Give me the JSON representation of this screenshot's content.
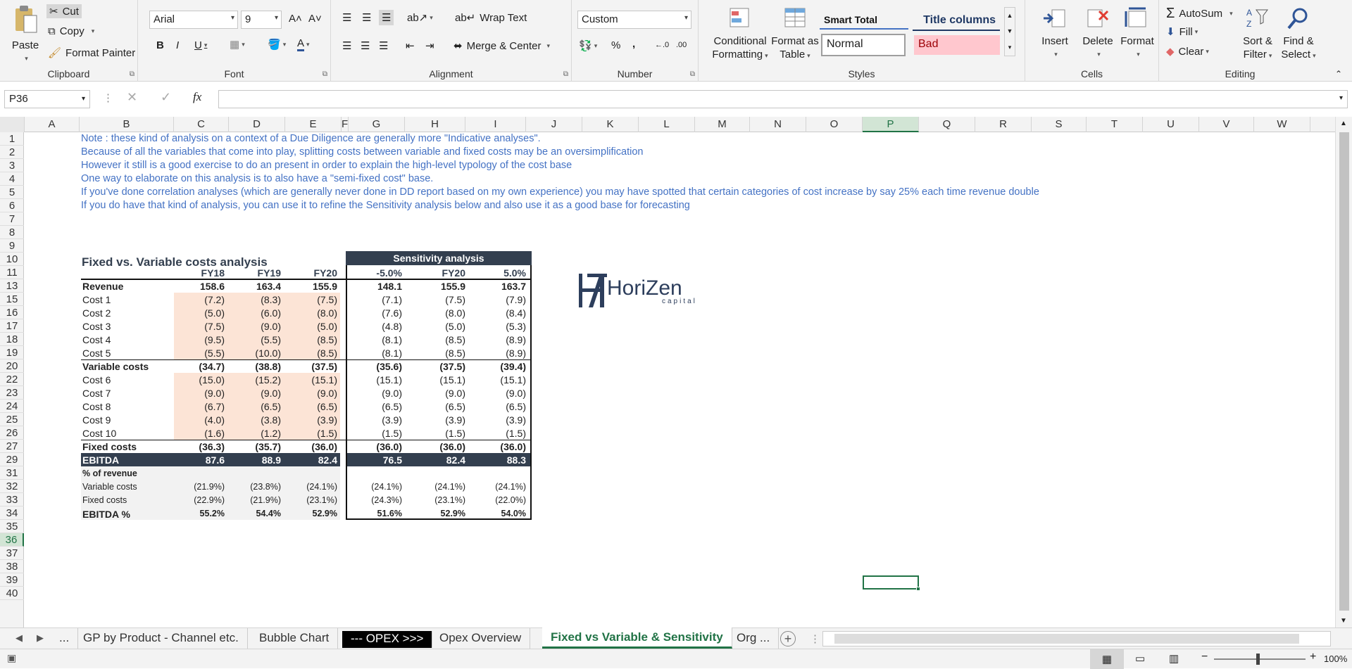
{
  "ribbon": {
    "clipboard": {
      "paste": "Paste",
      "cut": "Cut",
      "copy": "Copy",
      "format_painter": "Format Painter",
      "label": "Clipboard"
    },
    "font": {
      "name": "Arial",
      "size": "9",
      "label": "Font",
      "bold": "B",
      "italic": "I",
      "underline": "U"
    },
    "alignment": {
      "wrap_text": "Wrap Text",
      "merge_center": "Merge & Center",
      "label": "Alignment"
    },
    "number": {
      "format": "Custom",
      "percent": "%",
      "comma": ",",
      "label": "Number"
    },
    "styles": {
      "conditional": "Conditional",
      "conditional2": "Formatting",
      "format_as": "Format as",
      "format_as2": "Table",
      "smart_total": "Smart Total",
      "title_columns": "Title columns",
      "normal": "Normal",
      "bad": "Bad",
      "label": "Styles"
    },
    "cells": {
      "insert": "Insert",
      "delete": "Delete",
      "format": "Format",
      "label": "Cells"
    },
    "editing": {
      "autosum": "AutoSum",
      "fill": "Fill",
      "clear": "Clear",
      "sort": "Sort &",
      "sort2": "Filter",
      "find": "Find &",
      "find2": "Select",
      "label": "Editing"
    }
  },
  "formula_bar": {
    "name_box": "P36",
    "fx": "fx",
    "value": ""
  },
  "columns": [
    "A",
    "B",
    "C",
    "D",
    "E",
    "F",
    "G",
    "H",
    "I",
    "J",
    "K",
    "L",
    "M",
    "N",
    "O",
    "P",
    "Q",
    "R",
    "S",
    "T",
    "U",
    "V",
    "W"
  ],
  "rows": [
    "1",
    "2",
    "3",
    "4",
    "5",
    "6",
    "7",
    "8",
    "9",
    "10",
    "11",
    "13",
    "15",
    "16",
    "17",
    "18",
    "19",
    "20",
    "22",
    "23",
    "24",
    "25",
    "26",
    "27",
    "29",
    "31",
    "32",
    "33",
    "34",
    "35",
    "36",
    "37",
    "38",
    "39",
    "40"
  ],
  "notes": [
    "Note : these kind of analysis on a context of a Due Diligence are generally more \"Indicative analyses\".",
    "Because of all the variables that come into play, splitting costs between variable and fixed costs may be an oversimplification",
    "However it still is a good exercise to do an present in order to explain the high-level typology of the cost base",
    "One way to elaborate on this analysis is to also have a \"semi-fixed cost\" base.",
    "If you've done correlation analyses (which are generally never done in DD report based on my own experience) you may have spotted that certain categories of cost increase by say 25% each time revenue double",
    "If you do have that kind of analysis, you can use it to refine the Sensitivity analysis below and also use it as a good base for forecasting"
  ],
  "table": {
    "title": "Fixed vs. Variable costs analysis",
    "sensitivity_title": "Sensitivity analysis",
    "headers": [
      "FY18",
      "FY19",
      "FY20",
      "-5.0%",
      "FY20",
      "5.0%"
    ],
    "revenue": {
      "label": "Revenue",
      "values": [
        "158.6",
        "163.4",
        "155.9",
        "148.1",
        "155.9",
        "163.7"
      ]
    },
    "variable_rows": [
      {
        "label": "Cost 1",
        "values": [
          "(7.2)",
          "(8.3)",
          "(7.5)",
          "(7.1)",
          "(7.5)",
          "(7.9)"
        ]
      },
      {
        "label": "Cost 2",
        "values": [
          "(5.0)",
          "(6.0)",
          "(8.0)",
          "(7.6)",
          "(8.0)",
          "(8.4)"
        ]
      },
      {
        "label": "Cost 3",
        "values": [
          "(7.5)",
          "(9.0)",
          "(5.0)",
          "(4.8)",
          "(5.0)",
          "(5.3)"
        ]
      },
      {
        "label": "Cost 4",
        "values": [
          "(9.5)",
          "(5.5)",
          "(8.5)",
          "(8.1)",
          "(8.5)",
          "(8.9)"
        ]
      },
      {
        "label": "Cost 5",
        "values": [
          "(5.5)",
          "(10.0)",
          "(8.5)",
          "(8.1)",
          "(8.5)",
          "(8.9)"
        ]
      }
    ],
    "variable_total": {
      "label": "Variable costs",
      "values": [
        "(34.7)",
        "(38.8)",
        "(37.5)",
        "(35.6)",
        "(37.5)",
        "(39.4)"
      ]
    },
    "fixed_rows": [
      {
        "label": "Cost 6",
        "values": [
          "(15.0)",
          "(15.2)",
          "(15.1)",
          "(15.1)",
          "(15.1)",
          "(15.1)"
        ]
      },
      {
        "label": "Cost 7",
        "values": [
          "(9.0)",
          "(9.0)",
          "(9.0)",
          "(9.0)",
          "(9.0)",
          "(9.0)"
        ]
      },
      {
        "label": "Cost 8",
        "values": [
          "(6.7)",
          "(6.5)",
          "(6.5)",
          "(6.5)",
          "(6.5)",
          "(6.5)"
        ]
      },
      {
        "label": "Cost 9",
        "values": [
          "(4.0)",
          "(3.8)",
          "(3.9)",
          "(3.9)",
          "(3.9)",
          "(3.9)"
        ]
      },
      {
        "label": "Cost 10",
        "values": [
          "(1.6)",
          "(1.2)",
          "(1.5)",
          "(1.5)",
          "(1.5)",
          "(1.5)"
        ]
      }
    ],
    "fixed_total": {
      "label": "Fixed costs",
      "values": [
        "(36.3)",
        "(35.7)",
        "(36.0)",
        "(36.0)",
        "(36.0)",
        "(36.0)"
      ]
    },
    "ebitda": {
      "label": "EBITDA",
      "values": [
        "87.6",
        "88.9",
        "82.4",
        "76.5",
        "82.4",
        "88.3"
      ]
    },
    "pct_title": "% of revenue",
    "pct_rows": [
      {
        "label": "Variable costs",
        "values": [
          "(21.9%)",
          "(23.8%)",
          "(24.1%)",
          "(24.1%)",
          "(24.1%)",
          "(24.1%)"
        ]
      },
      {
        "label": "Fixed costs",
        "values": [
          "(22.9%)",
          "(21.9%)",
          "(23.1%)",
          "(24.3%)",
          "(23.1%)",
          "(22.0%)"
        ]
      },
      {
        "label": "EBITDA %",
        "values": [
          "55.2%",
          "54.4%",
          "52.9%",
          "51.6%",
          "52.9%",
          "54.0%"
        ]
      }
    ]
  },
  "logo": {
    "name": "HoriZen",
    "sub": "capital"
  },
  "tabs": [
    "...",
    "GP by Product - Channel etc.",
    "Bubble Chart",
    "--- OPEX >>>",
    "Opex Overview",
    "Fixed vs Variable & Sensitivity",
    "Org ..."
  ],
  "active_tab": "Fixed vs Variable & Sensitivity",
  "status": {
    "zoom": "100%"
  },
  "colors": {
    "accent": "#217346",
    "header_dark": "#333f4f",
    "cost_fill": "#fce4d6",
    "note_blue": "#4472c4",
    "title_navy": "#1f3864"
  }
}
